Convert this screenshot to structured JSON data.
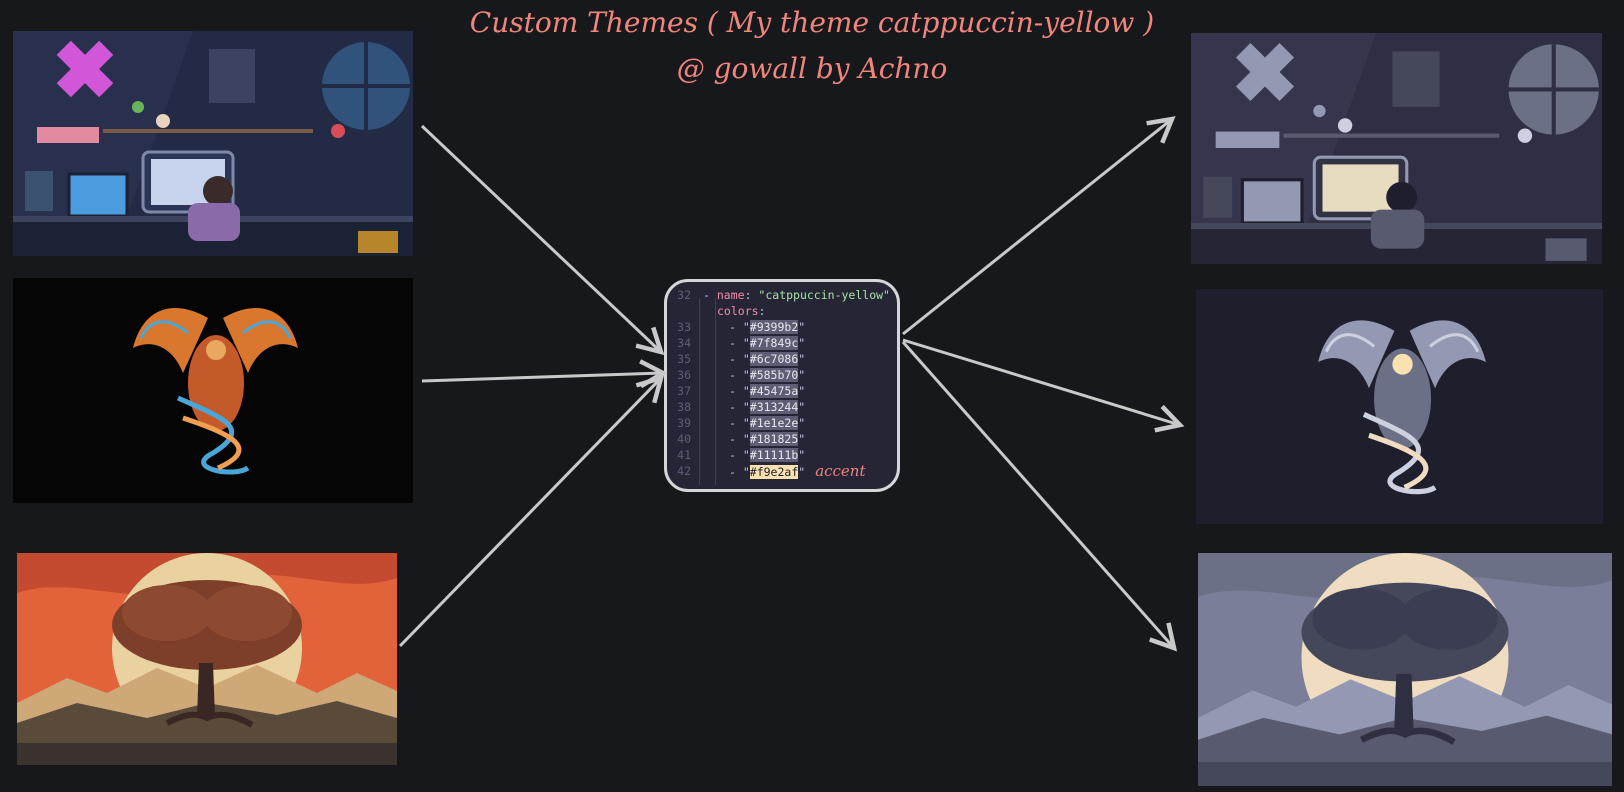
{
  "title": "Custom Themes ( My theme catppuccin-yellow )",
  "subtitle": "@ gowall by Achno",
  "theme": {
    "line_numbers": [
      "32",
      "33",
      "34",
      "35",
      "36",
      "37",
      "38",
      "39",
      "40",
      "41",
      "42"
    ],
    "name_key": "name",
    "name_value": "\"catppuccin-yellow\"",
    "colors_key": "colors",
    "colors": [
      "#9399b2",
      "#7f849c",
      "#6c7086",
      "#585b70",
      "#45475a",
      "#313244",
      "#1e1e2e",
      "#181825",
      "#11111b",
      "#f9e2af"
    ],
    "accent_label": "accent"
  },
  "palette": {
    "background": "#17181b",
    "title": "#f0857b",
    "arrow": "#c9c9c9",
    "accent": "#f9e2af"
  },
  "images": {
    "left": [
      {
        "name": "pixel-room-original"
      },
      {
        "name": "phoenix-original"
      },
      {
        "name": "tree-sunset-original"
      }
    ],
    "right": [
      {
        "name": "pixel-room-themed"
      },
      {
        "name": "phoenix-themed"
      },
      {
        "name": "tree-moon-themed"
      }
    ]
  }
}
